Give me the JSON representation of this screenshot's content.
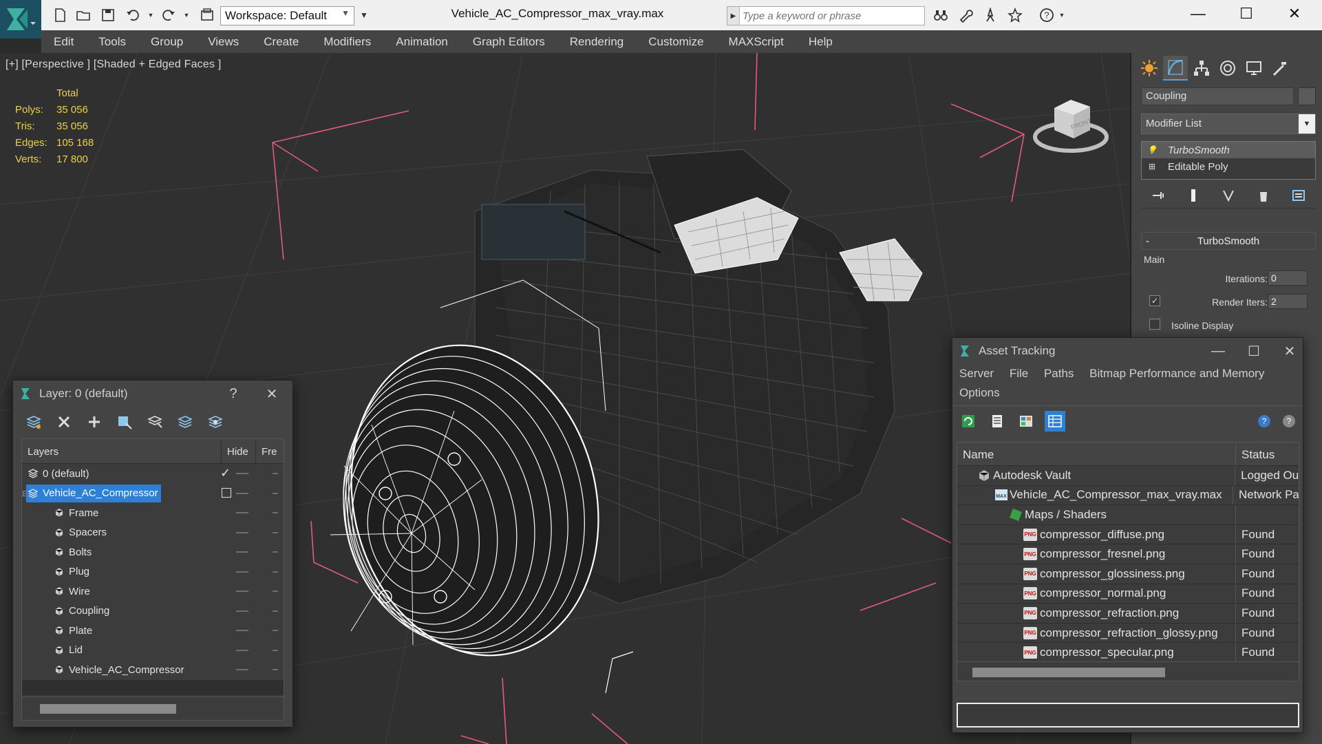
{
  "titlebar": {
    "workspace_label": "Workspace: Default",
    "document_title": "Vehicle_AC_Compressor_max_vray.max",
    "search_placeholder": "Type a keyword or phrase",
    "icons": [
      "new-file-icon",
      "open-folder-icon",
      "save-icon",
      "undo-icon",
      "redo-icon",
      "project-folder-icon",
      "binoculars-icon",
      "wrench-icon",
      "star-search-icon",
      "favorite-star-icon",
      "help-icon"
    ]
  },
  "menubar": {
    "items": [
      "Edit",
      "Tools",
      "Group",
      "Views",
      "Create",
      "Modifiers",
      "Animation",
      "Graph Editors",
      "Rendering",
      "Customize",
      "MAXScript",
      "Help"
    ]
  },
  "viewport": {
    "label": "[+] [Perspective ] [Shaded + Edged Faces ]",
    "stats": {
      "total_label": "Total",
      "rows": [
        {
          "key": "Polys:",
          "value": "35 056"
        },
        {
          "key": "Tris:",
          "value": "35 056"
        },
        {
          "key": "Edges:",
          "value": "105 168"
        },
        {
          "key": "Verts:",
          "value": "17 800"
        }
      ]
    },
    "viewcube_face": "FRONT",
    "colors": {
      "stats": "#e8d24a",
      "bounding_box": "#e35a7a",
      "wireframe": "#ffffff"
    }
  },
  "command_panel": {
    "object_name": "Coupling",
    "modifier_list_label": "Modifier List",
    "stack": [
      {
        "label": "TurboSmooth",
        "selected": true
      },
      {
        "label": "Editable Poly",
        "selected": false
      }
    ],
    "rollout": {
      "title": "TurboSmooth",
      "group": "Main",
      "iterations_label": "Iterations:",
      "iterations_value": "0",
      "render_iters_label": "Render Iters:",
      "render_iters_value": "2",
      "render_iters_checked": true,
      "isoline_label": "Isoline Display",
      "isoline_checked": false
    }
  },
  "layer_explorer": {
    "title": "Layer: 0 (default)",
    "help": "?",
    "columns": [
      "Layers",
      "Hide",
      "Fre"
    ],
    "rows": [
      {
        "name": "0 (default)",
        "level": 0,
        "type": "layer",
        "selected": false,
        "active": true
      },
      {
        "name": "Vehicle_AC_Compressor",
        "level": 0,
        "type": "layer",
        "selected": true,
        "active": false
      },
      {
        "name": "Frame",
        "level": 1,
        "type": "object",
        "selected": false,
        "active": false
      },
      {
        "name": "Spacers",
        "level": 1,
        "type": "object",
        "selected": false,
        "active": false
      },
      {
        "name": "Bolts",
        "level": 1,
        "type": "object",
        "selected": false,
        "active": false
      },
      {
        "name": "Plug",
        "level": 1,
        "type": "object",
        "selected": false,
        "active": false
      },
      {
        "name": "Wire",
        "level": 1,
        "type": "object",
        "selected": false,
        "active": false
      },
      {
        "name": "Coupling",
        "level": 1,
        "type": "object",
        "selected": false,
        "active": false
      },
      {
        "name": "Plate",
        "level": 1,
        "type": "object",
        "selected": false,
        "active": false
      },
      {
        "name": "Lid",
        "level": 1,
        "type": "object",
        "selected": false,
        "active": false
      },
      {
        "name": "Vehicle_AC_Compressor",
        "level": 1,
        "type": "object",
        "selected": false,
        "active": false
      }
    ]
  },
  "asset_tracking": {
    "title": "Asset Tracking",
    "menu": [
      "Server",
      "File",
      "Paths",
      "Bitmap Performance and Memory",
      "Options"
    ],
    "columns": [
      "Name",
      "Status"
    ],
    "rows": [
      {
        "name": "Autodesk Vault",
        "status": "Logged Ou",
        "level": 0,
        "icon": "vault-icon"
      },
      {
        "name": "Vehicle_AC_Compressor_max_vray.max",
        "status": "Network Pa",
        "level": 1,
        "icon": "max-file-icon"
      },
      {
        "name": "Maps / Shaders",
        "status": "",
        "level": 2,
        "icon": "maps-icon"
      },
      {
        "name": "compressor_diffuse.png",
        "status": "Found",
        "level": 3,
        "icon": "png-icon"
      },
      {
        "name": "compressor_fresnel.png",
        "status": "Found",
        "level": 3,
        "icon": "png-icon"
      },
      {
        "name": "compressor_glossiness.png",
        "status": "Found",
        "level": 3,
        "icon": "png-icon"
      },
      {
        "name": "compressor_normal.png",
        "status": "Found",
        "level": 3,
        "icon": "png-icon"
      },
      {
        "name": "compressor_refraction.png",
        "status": "Found",
        "level": 3,
        "icon": "png-icon"
      },
      {
        "name": "compressor_refraction_glossy.png",
        "status": "Found",
        "level": 3,
        "icon": "png-icon"
      },
      {
        "name": "compressor_specular.png",
        "status": "Found",
        "level": 3,
        "icon": "png-icon"
      }
    ],
    "png_badge": "PNG"
  }
}
